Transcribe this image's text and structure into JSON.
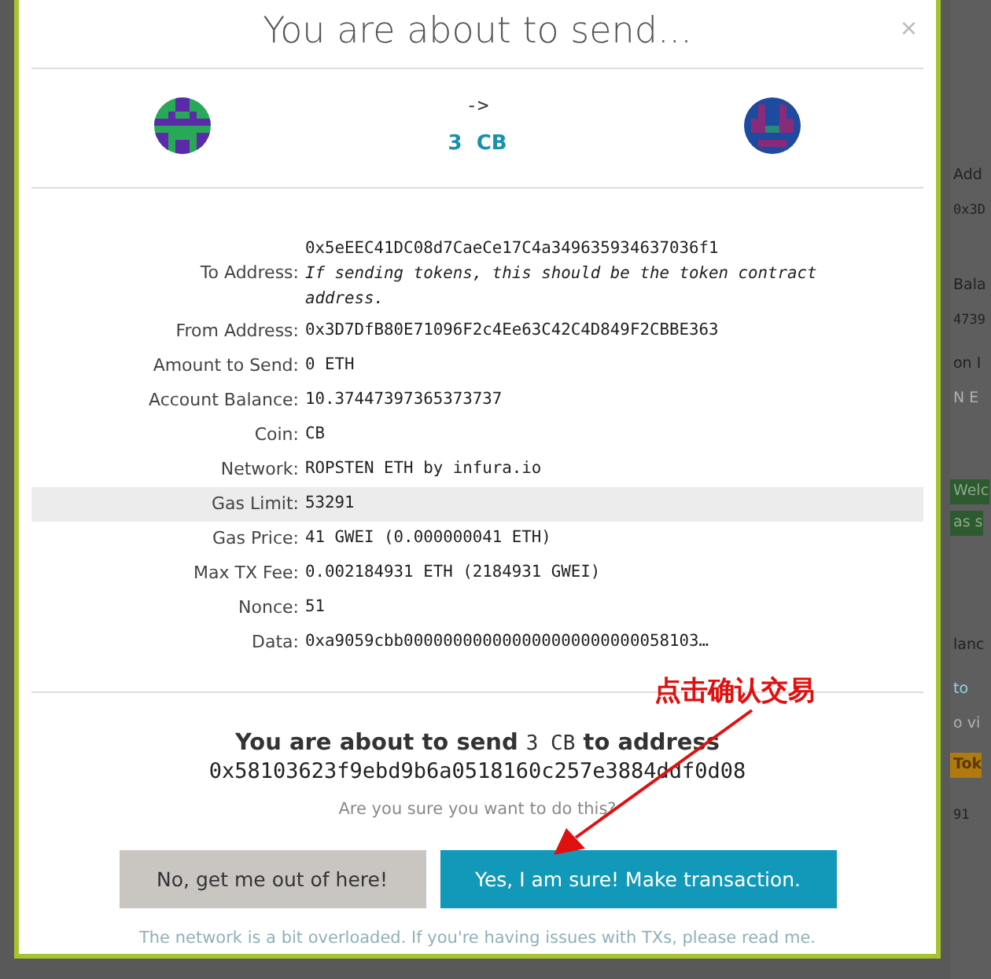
{
  "modal": {
    "title": "You are about to send...",
    "close": "×",
    "arrow": "->",
    "amount": "3",
    "unit": "CB",
    "rows": [
      {
        "label": "To Address:",
        "value": "0x5eEEC41DC08d7CaeCe17C4a349635934637036f1",
        "note": "If sending tokens, this should be the token contract address.",
        "highlighted": false
      },
      {
        "label": "From Address:",
        "value": "0x3D7DfB80E71096F2c4Ee63C42C4D849F2CBBE363",
        "highlighted": false
      },
      {
        "label": "Amount to Send:",
        "value": "0 ETH",
        "highlighted": false
      },
      {
        "label": "Account Balance:",
        "value": "10.37447397365373737",
        "highlighted": false
      },
      {
        "label": "Coin:",
        "value": "CB",
        "highlighted": false
      },
      {
        "label": "Network:",
        "value": "ROPSTEN ETH by infura.io",
        "highlighted": false
      },
      {
        "label": "Gas Limit:",
        "value": "53291",
        "highlighted": true
      },
      {
        "label": "Gas Price:",
        "value": "41 GWEI (0.000000041 ETH)",
        "highlighted": false
      },
      {
        "label": "Max TX Fee:",
        "value": "0.002184931 ETH (2184931 GWEI)",
        "highlighted": false
      },
      {
        "label": "Nonce:",
        "value": "51",
        "highlighted": false
      },
      {
        "label": "Data:",
        "value": "0xa9059cbb000000000000000000000000058103…",
        "highlighted": false
      }
    ],
    "summary_prefix": "You are about to send",
    "summary_amount": "3 CB",
    "summary_suffix": "to address",
    "to_address": "0x58103623f9ebd9b6a0518160c257e3884ddf0d08",
    "question": "Are you sure you want to do this?",
    "buttons": [
      {
        "label": "No, get me out of here!",
        "kind": "cancel"
      },
      {
        "label": "Yes, I am sure! Make transaction.",
        "kind": "confirm"
      }
    ],
    "footer": "The network is a bit overloaded. If you're having issues with TXs, please read me."
  },
  "annotation": {
    "text": "点击确认交易"
  },
  "background_fragments": [
    {
      "text": "Add",
      "kind": "text"
    },
    {
      "text": "0x3D",
      "kind": "mono"
    },
    {
      "text": "Bala",
      "kind": "text"
    },
    {
      "text": "4739",
      "kind": "mono"
    },
    {
      "text": "on I",
      "kind": "text"
    },
    {
      "text": "N E",
      "kind": "faint"
    },
    {
      "text": "Welc",
      "kind": "green"
    },
    {
      "text": "as s",
      "kind": "green"
    },
    {
      "text": "lanc",
      "kind": "text"
    },
    {
      "text": "to",
      "kind": "link"
    },
    {
      "text": "o vi",
      "kind": "faint"
    },
    {
      "text": "Tok",
      "kind": "orange"
    },
    {
      "text": "91",
      "kind": "mono"
    }
  ]
}
